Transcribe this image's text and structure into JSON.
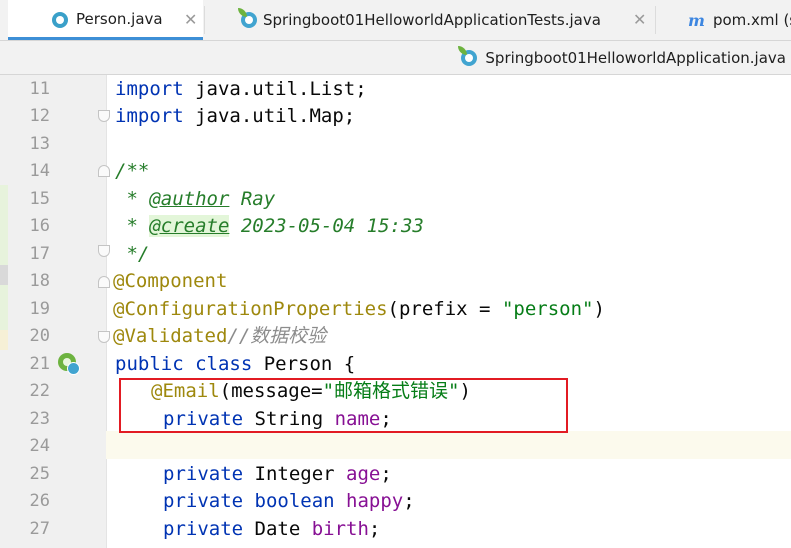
{
  "tabs": [
    {
      "label": "Person.java",
      "icon": "java-class-icon",
      "active": true
    },
    {
      "label": "Springboot01HelloworldApplicationTests.java",
      "icon": "spring-java-class-icon",
      "active": false
    },
    {
      "label": "pom.xml (s",
      "icon": "maven-m-icon",
      "active": false
    }
  ],
  "second_row_tab": {
    "label": "Springboot01HelloworldApplication.java",
    "icon": "spring-java-class-icon"
  },
  "line_numbers": [
    "11",
    "12",
    "13",
    "14",
    "15",
    "16",
    "17",
    "18",
    "19",
    "20",
    "21",
    "22",
    "23",
    "24",
    "25",
    "26",
    "27"
  ],
  "code": {
    "l11": {
      "kw": "import",
      "rest": " java.util.List;"
    },
    "l12": {
      "kw": "import",
      "rest": " java.util.Map;"
    },
    "l14": "/**",
    "l15": {
      "star": " * ",
      "tag": "@author",
      "val": " Ray"
    },
    "l16": {
      "star": " * ",
      "tag": "@create",
      "val": " 2023-05-04 15:33"
    },
    "l17": " */",
    "l18": "@Component",
    "l19": {
      "ann": "@ConfigurationProperties",
      "open": "(prefix = ",
      "str": "\"person\"",
      "close": ")"
    },
    "l20": {
      "ann": "@Validated",
      "comment": "//数据校验"
    },
    "l21": {
      "kw1": "public",
      "kw2": "class",
      "rest": " Person {"
    },
    "l22": {
      "ann": "@Email",
      "open": "(message=",
      "str": "\"邮箱格式错误\"",
      "close": ")"
    },
    "l23": {
      "kw": "private",
      "type": " String ",
      "field": "name",
      "end": ";"
    },
    "l25": {
      "kw": "private",
      "type": " Integer ",
      "field": "age",
      "end": ";"
    },
    "l26": {
      "kw": "private",
      "kw2": " boolean ",
      "field": "happy",
      "end": ";"
    },
    "l27": {
      "kw": "private",
      "type": " Date ",
      "field": "birth",
      "end": ";"
    }
  },
  "colors": {
    "keyword": "#0033b3",
    "annotation": "#9e880d",
    "string": "#067d17",
    "field": "#871094",
    "doc_comment": "#267d2a",
    "line_comment": "#8c8c8c",
    "highlight_box": "#e21b23"
  }
}
